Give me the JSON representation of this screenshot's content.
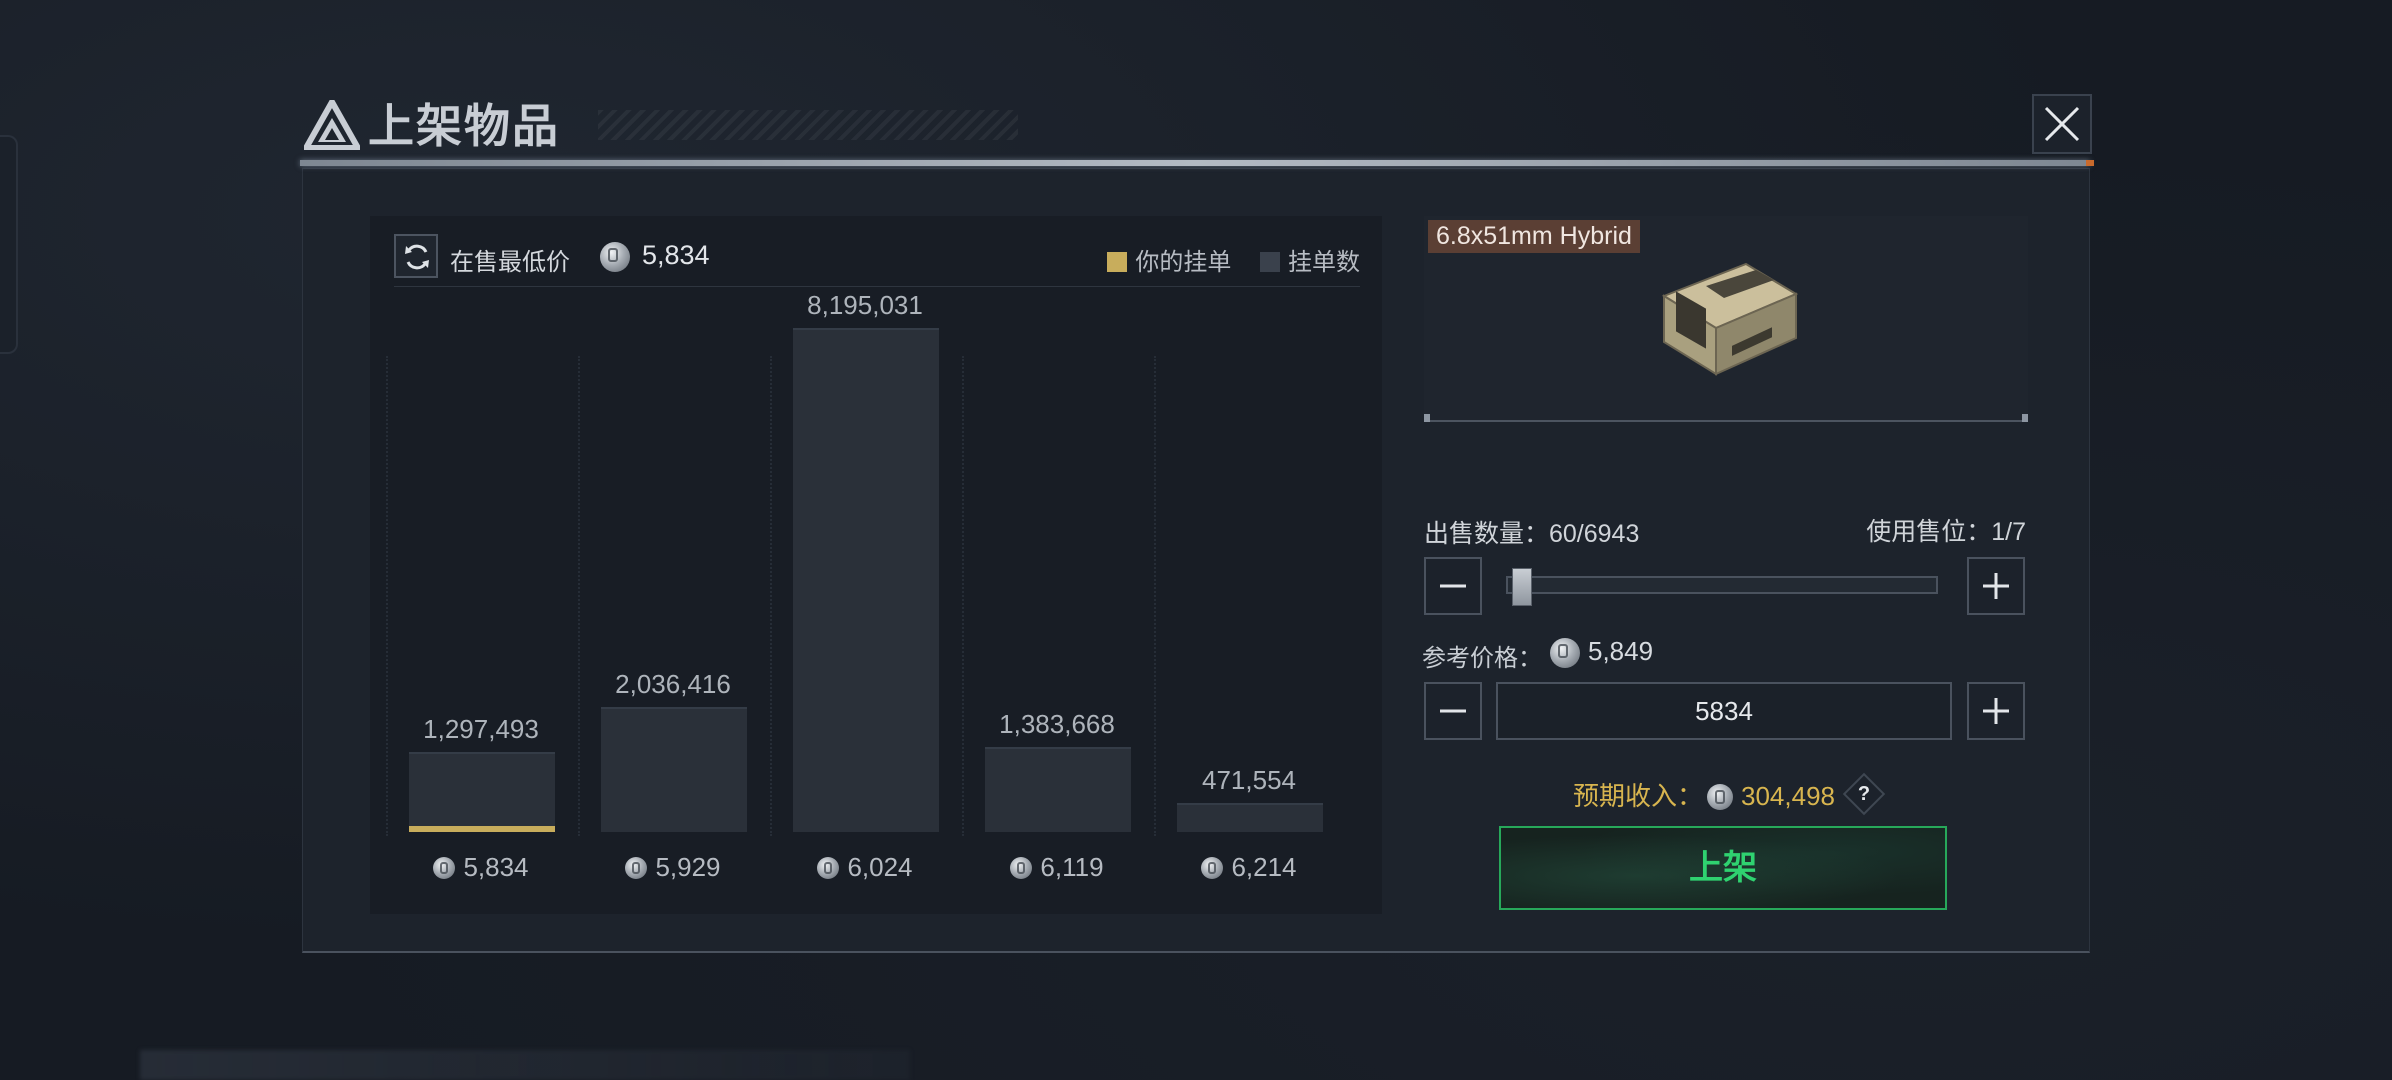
{
  "header": {
    "title": "上架物品"
  },
  "chart_panel": {
    "lowest_label": "在售最低价",
    "lowest_value": "5,834",
    "legend": [
      {
        "label": "你的挂单",
        "color": "#c8ad5c"
      },
      {
        "label": "挂单数",
        "color": "#3a414c"
      }
    ]
  },
  "chart_data": {
    "type": "bar",
    "categories": [
      "5,834",
      "5,929",
      "6,024",
      "6,119",
      "6,214"
    ],
    "series": [
      {
        "name": "挂单数",
        "values": [
          1297493,
          2036416,
          8195031,
          1383668,
          471554
        ]
      }
    ],
    "value_labels": [
      "1,297,493",
      "2,036,416",
      "8,195,031",
      "1,383,668",
      "471,554"
    ],
    "mine_index": 0,
    "ylim": [
      0,
      8195031
    ]
  },
  "item": {
    "name": "6.8x51mm Hybrid"
  },
  "sale": {
    "qty_label": "出售数量：60/6943",
    "slot_label": "使用售位：1/7",
    "qty_fraction": 0.0086,
    "ref_label": "参考价格：",
    "ref_value": "5,849",
    "price_input": "5834",
    "expected_label": "预期收入：",
    "expected_value": "304,498",
    "help": "?",
    "list_button": "上架"
  }
}
